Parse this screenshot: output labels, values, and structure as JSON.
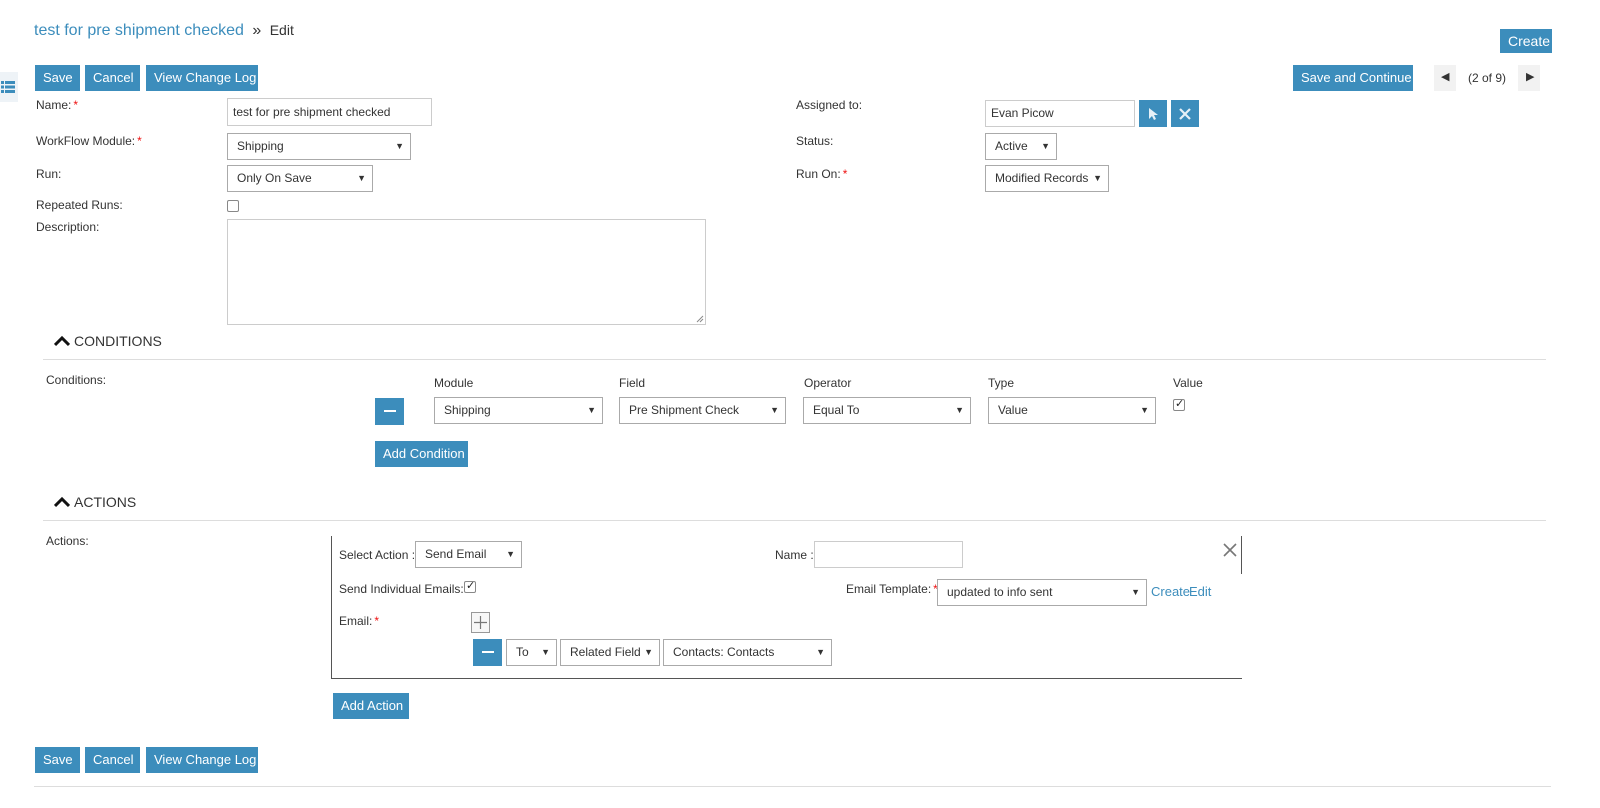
{
  "breadcrumb": {
    "record": "test for pre shipment checked",
    "separator": "»",
    "mode": "Edit"
  },
  "header": {
    "create_label": "Create",
    "save_continue_label": "Save and Continue",
    "pager": "(2 of 9)"
  },
  "toolbar": {
    "save": "Save",
    "cancel": "Cancel",
    "change_log": "View Change Log"
  },
  "form": {
    "name_label": "Name:",
    "name_value": "test for pre shipment checked",
    "module_label": "WorkFlow Module:",
    "module_value": "Shipping",
    "run_label": "Run:",
    "run_value": "Only On Save",
    "repeated_label": "Repeated Runs:",
    "description_label": "Description:",
    "assigned_label": "Assigned to:",
    "assigned_value": "Evan Picow",
    "status_label": "Status:",
    "status_value": "Active",
    "run_on_label": "Run On:",
    "run_on_value": "Modified Records"
  },
  "conditions": {
    "section_title": "CONDITIONS",
    "label": "Conditions:",
    "columns": {
      "module": "Module",
      "field": "Field",
      "operator": "Operator",
      "type": "Type",
      "value": "Value"
    },
    "row": {
      "module": "Shipping",
      "field": "Pre Shipment Check",
      "operator": "Equal To",
      "type": "Value",
      "value_checked": true
    },
    "add_label": "Add Condition"
  },
  "actions": {
    "section_title": "ACTIONS",
    "label": "Actions:",
    "select_action_label": "Select Action :",
    "select_action_value": "Send Email",
    "name_label": "Name :",
    "name_value": "",
    "individual_label": "Send Individual Emails:",
    "template_label": "Email Template:",
    "template_value": "updated to info sent",
    "create_link": "Create",
    "edit_link": "Edit",
    "email_label": "Email:",
    "email_row": {
      "to": "To",
      "field_type": "Related Field",
      "contact": "Contacts: Contacts"
    },
    "add_label": "Add Action"
  },
  "icons": {
    "list": "list-icon",
    "select": "select-arrow-icon",
    "clear": "clear-icon",
    "close": "close-icon",
    "prev": "chevron-left-icon",
    "next": "chevron-right-icon"
  },
  "colors": {
    "accent": "#3c8dbc",
    "required": "#ee1111"
  }
}
